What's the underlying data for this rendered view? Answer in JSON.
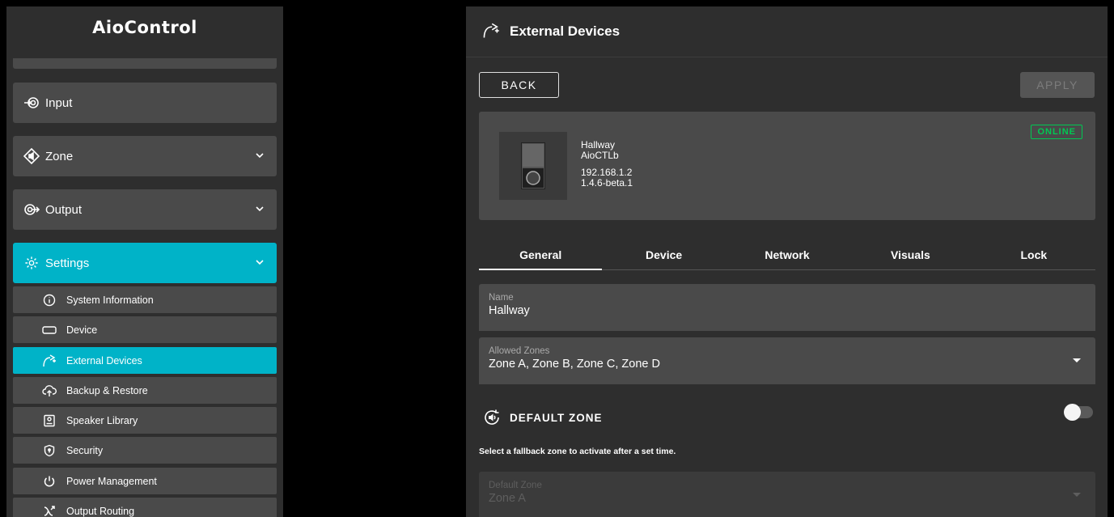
{
  "sidebar": {
    "brand": "AioControl",
    "nav": [
      {
        "label": "Input",
        "icon": "input-icon",
        "expandable": false
      },
      {
        "label": "Zone",
        "icon": "zone-speaker-icon",
        "expandable": true
      },
      {
        "label": "Output",
        "icon": "output-icon",
        "expandable": true
      },
      {
        "label": "Settings",
        "icon": "gear-icon",
        "expandable": true,
        "active": true
      }
    ],
    "settings_items": [
      {
        "label": "System Information",
        "icon": "info-icon"
      },
      {
        "label": "Device",
        "icon": "device-icon"
      },
      {
        "label": "External Devices",
        "icon": "external-devices-icon",
        "active": true
      },
      {
        "label": "Backup & Restore",
        "icon": "cloud-upload-icon"
      },
      {
        "label": "Speaker Library",
        "icon": "speaker-library-icon"
      },
      {
        "label": "Security",
        "icon": "shield-icon"
      },
      {
        "label": "Power Management",
        "icon": "power-icon"
      },
      {
        "label": "Output Routing",
        "icon": "routing-icon"
      }
    ]
  },
  "main": {
    "title": "External Devices",
    "back_label": "BACK",
    "apply_label": "APPLY",
    "device": {
      "name": "Hallway",
      "model": "AioCTLb",
      "ip": "192.168.1.2",
      "firmware": "1.4.6-beta.1",
      "status": "ONLINE"
    },
    "tabs": [
      "General",
      "Device",
      "Network",
      "Visuals",
      "Lock"
    ],
    "active_tab": "General",
    "name_field": {
      "label": "Name",
      "value": "Hallway"
    },
    "zones_field": {
      "label": "Allowed Zones",
      "value": "Zone A, Zone B, Zone C, Zone D"
    },
    "default_zone_section": {
      "title": "DEFAULT ZONE",
      "toggle_on": false,
      "hint": "Select a fallback zone to activate after a set time."
    },
    "default_zone_field": {
      "label": "Default Zone",
      "value": "Zone A",
      "disabled": true
    }
  },
  "colors": {
    "accent": "#00b3c8",
    "online": "#00c853",
    "panel": "#2e2e2e",
    "card": "#4a4a4a"
  }
}
